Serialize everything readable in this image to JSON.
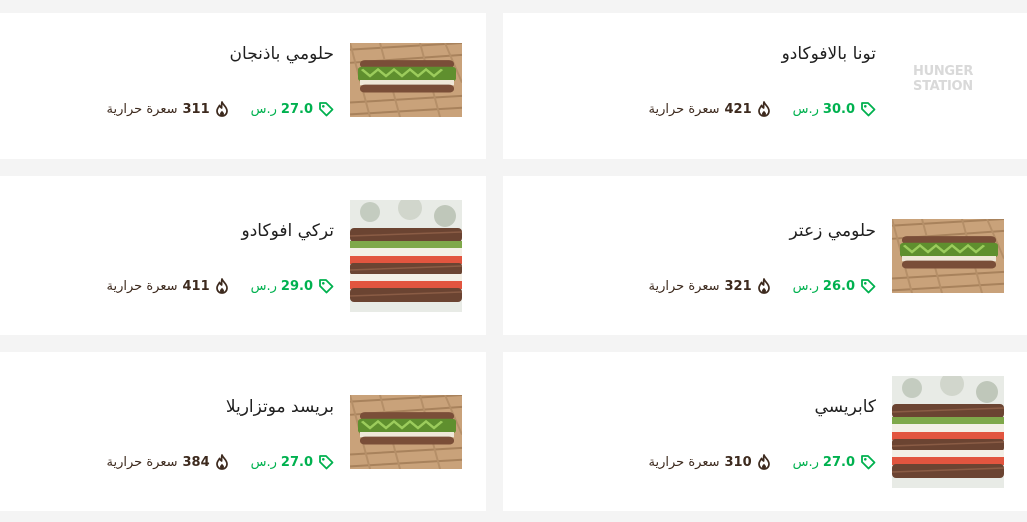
{
  "currency": "ر.س",
  "calorie_unit": "سعرة حرارية",
  "brand": {
    "line1": "HUNGER",
    "line2": "STATION"
  },
  "items": [
    {
      "name": "حلومي باذنجان",
      "price": "27.0",
      "calories": "311"
    },
    {
      "name": "تونا بالافوكادو",
      "price": "30.0",
      "calories": "421"
    },
    {
      "name": "تركي افوكادو",
      "price": "29.0",
      "calories": "411"
    },
    {
      "name": "حلومي زعتر",
      "price": "26.0",
      "calories": "321"
    },
    {
      "name": "بريسد موتزاريلا",
      "price": "27.0",
      "calories": "384"
    },
    {
      "name": "كابريسي",
      "price": "27.0",
      "calories": "310"
    }
  ],
  "colors": {
    "accent_green": "#00b14f",
    "calorie_text": "#3d2a1e",
    "background": "#f4f4f4"
  }
}
